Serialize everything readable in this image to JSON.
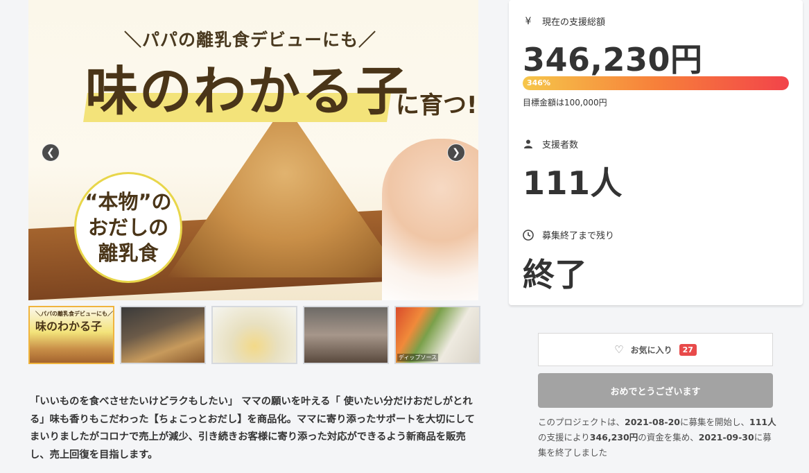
{
  "hero": {
    "tagline": "＼パパの離乳食デビューにも／",
    "headline": "味のわかる子",
    "headline_suffix": "に育つ!",
    "badge_lines": [
      "“本物”の",
      "おだしの",
      "離乳食"
    ],
    "prev_icon": "chevron-left-icon",
    "next_icon": "chevron-right-icon"
  },
  "thumbnails": [
    {
      "caption_small": "＼パパの離乳食デビューにも／",
      "caption_large": "味のわかる子",
      "active": true
    },
    {
      "active": false
    },
    {
      "active": false
    },
    {
      "active": false
    },
    {
      "caption_bottom": "ディップソース",
      "active": false
    }
  ],
  "description": "「いいものを食べさせたいけどラクもしたい」 ママの願いを叶える「 使いたい分だけおだしがとれる」味も香りもこだわった【ちょこっとおだし】を商品化。ママに寄り添ったサポートを大切にしてまいりましたがコロナで売上が減少、引き続きお客様に寄り添った対応ができるよう新商品を販売し、売上回復を目指します。",
  "stats": {
    "total": {
      "icon": "yen-icon",
      "icon_glyph": "¥",
      "label": "現在の支援総額",
      "value": "346,230円"
    },
    "progress": {
      "percent_label": "346%",
      "percent": 346
    },
    "goal_text": "目標金額は100,000円",
    "supporters": {
      "icon": "user-icon",
      "label": "支援者数",
      "value": "111人"
    },
    "remaining": {
      "icon": "clock-icon",
      "label": "募集終了まで残り",
      "value": "終了"
    }
  },
  "favorite": {
    "icon": "heart-icon",
    "label": "お気に入り",
    "count": "27"
  },
  "congrats_button": "おめでとうございます",
  "summary": {
    "prefix": "このプロジェクトは、",
    "start_date": "2021-08-20",
    "mid1": "に募集を開始し、",
    "supporters": "111人",
    "mid2": "の支援により",
    "amount": "346,230円",
    "mid3": "の資金を集め、",
    "end_date": "2021-09-30",
    "suffix": "に募集を終了しました"
  }
}
